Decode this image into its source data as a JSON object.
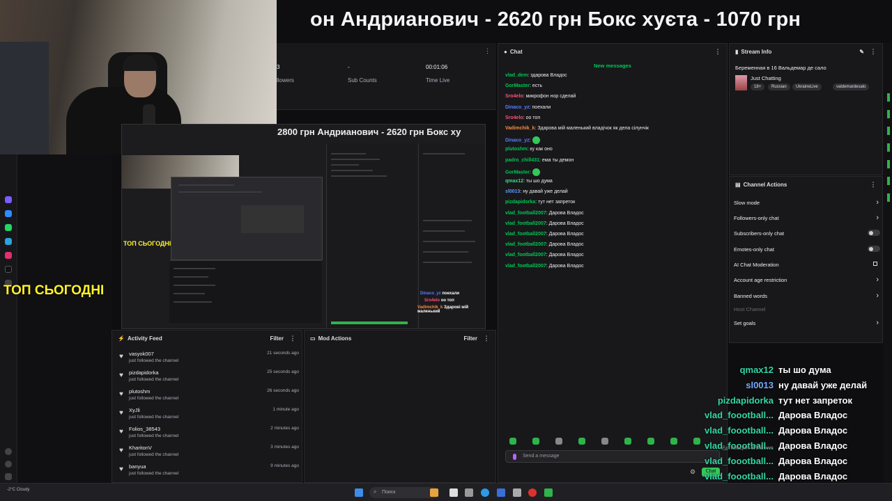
{
  "ticker": {
    "text": "он   Андрианович  -  2620 грн    Бокс хуєта  -  1070 грн"
  },
  "overlay": {
    "top_today": "ТОП СЬОГОДНІ",
    "nested_ticker": "2800 грн   Андрианович  -  2620 грн   Бокс ху"
  },
  "stats": [
    {
      "value": "3",
      "label": "llowers"
    },
    {
      "value": "-",
      "label": "Sub Counts"
    },
    {
      "value": "00:01:06",
      "label": "Time Live"
    }
  ],
  "activity_feed": {
    "title": "Activity Feed",
    "filter_label": "Filter",
    "items": [
      {
        "name": "vasyok007",
        "action": "just followed the channel",
        "time": "21 seconds ago"
      },
      {
        "name": "pizdapidorka",
        "action": "just followed the channel",
        "time": "25 seconds ago"
      },
      {
        "name": "plutoshm",
        "action": "just followed the channel",
        "time": "26 seconds ago"
      },
      {
        "name": "XyJli",
        "action": "just followed the channel",
        "time": "1 minute ago"
      },
      {
        "name": "Folios_38543",
        "action": "just followed the channel",
        "time": "2 minutes ago"
      },
      {
        "name": "KharitonV",
        "action": "just followed the channel",
        "time": "3 minutes ago"
      },
      {
        "name": "banyua",
        "action": "just followed the channel",
        "time": "9 minutes ago"
      }
    ]
  },
  "mod_actions": {
    "title": "Mod Actions",
    "filter_label": "Filter"
  },
  "chat": {
    "title": "Chat",
    "new_messages": "New messages",
    "messages": [
      {
        "user": "vlad_dem",
        "color": "#00c853",
        "text": "здарова Владос"
      },
      {
        "user": "GorMaster",
        "color": "#00c853",
        "text": "есть"
      },
      {
        "user": "Sro4elo",
        "color": "#ff4f7b",
        "text": "микрофон нор сделай"
      },
      {
        "user": "Dinaco_yz",
        "color": "#5b7cff",
        "text": "поехали"
      },
      {
        "user": "Sro4elo",
        "color": "#ff4f7b",
        "text": "оо топ"
      },
      {
        "user": "Vadimchik_k",
        "color": "#ff8a3d",
        "text": "Здарова мій маленький владічок як дела сілунчік"
      },
      {
        "user": "Dinaco_yz",
        "color": "#5b7cff",
        "text": ""
      },
      {
        "user": "plutoshm",
        "color": "#00c853",
        "text": "ку как оно"
      },
      {
        "user": "padro_chill431",
        "color": "#00c853",
        "text": "ема ты демон"
      },
      {
        "user": "GorMaster",
        "color": "#00c853",
        "text": ""
      },
      {
        "user": "qmax12",
        "color": "#3ddc84",
        "text": "ты шо дума"
      },
      {
        "user": "sl0013",
        "color": "#5b9cff",
        "text": "ну давай уже делай"
      },
      {
        "user": "pizdapidorka",
        "color": "#00c853",
        "text": "тут нет запреток"
      },
      {
        "user": "vlad_football2007",
        "color": "#00c853",
        "text": "Дарова Владос"
      },
      {
        "user": "vlad_football2007",
        "color": "#00c853",
        "text": "Дарова Владос"
      },
      {
        "user": "vlad_football2007",
        "color": "#00c853",
        "text": "Дарова Владос"
      },
      {
        "user": "vlad_football2007",
        "color": "#00c853",
        "text": "Дарова Владос"
      },
      {
        "user": "vlad_football2007",
        "color": "#00c853",
        "text": "Дарова Владос"
      },
      {
        "user": "vlad_football2007",
        "color": "#00c853",
        "text": "Дарова Владос"
      }
    ],
    "input_placeholder": "Send a message",
    "send_label": "Chat"
  },
  "stream_info": {
    "title": "Stream Info",
    "stream_title": "Беременная в 16 Вальдемар де сало",
    "category": "Just Chatting",
    "tags": [
      "18+",
      "Russian",
      "UkraineLive",
      "valdemardesalo"
    ]
  },
  "channel_actions": {
    "title": "Channel Actions",
    "items": [
      {
        "label": "Slow mode",
        "control": "chevron"
      },
      {
        "label": "Followers-only chat",
        "control": "chevron"
      },
      {
        "label": "Subscribers-only chat",
        "control": "toggle"
      },
      {
        "label": "Emotes-only chat",
        "control": "toggle"
      },
      {
        "label": "AI Chat Moderation",
        "control": "external"
      },
      {
        "label": "Account age restriction",
        "control": "chevron"
      },
      {
        "label": "Banned words",
        "control": "chevron"
      },
      {
        "label": "Host Channel",
        "control": "none",
        "disabled": true
      },
      {
        "label": "Set goals",
        "control": "chevron"
      }
    ]
  },
  "overlay_chat": [
    {
      "user": "qmax12",
      "color": "#35d6a6",
      "text": "ты шо дума"
    },
    {
      "user": "sl0013",
      "color": "#7aa9ff",
      "text": "ну давай уже делай"
    },
    {
      "user": "pizdapidorka",
      "color": "#35d6a6",
      "text": "тут нет запреток"
    },
    {
      "user": "vlad_foootball...",
      "color": "#35d6a6",
      "text": "Дарова Владос"
    },
    {
      "user": "vlad_foootball...",
      "color": "#35d6a6",
      "text": "Дарова Владос"
    },
    {
      "user": "vlad_foootball...",
      "color": "#35d6a6",
      "text": "Дарова Владос"
    },
    {
      "user": "vlad_foootball...",
      "color": "#35d6a6",
      "text": "Дарова Владос"
    },
    {
      "user": "vlad_foootball...",
      "color": "#35d6a6",
      "text": "Дарова Владос"
    },
    {
      "user": "vlad_foootball...",
      "color": "#35d6a6",
      "text": "Дарова Владос"
    }
  ],
  "windows": {
    "activate": "Активация Windows",
    "search": "Поиск",
    "weather": "-2°C Cloudy"
  }
}
